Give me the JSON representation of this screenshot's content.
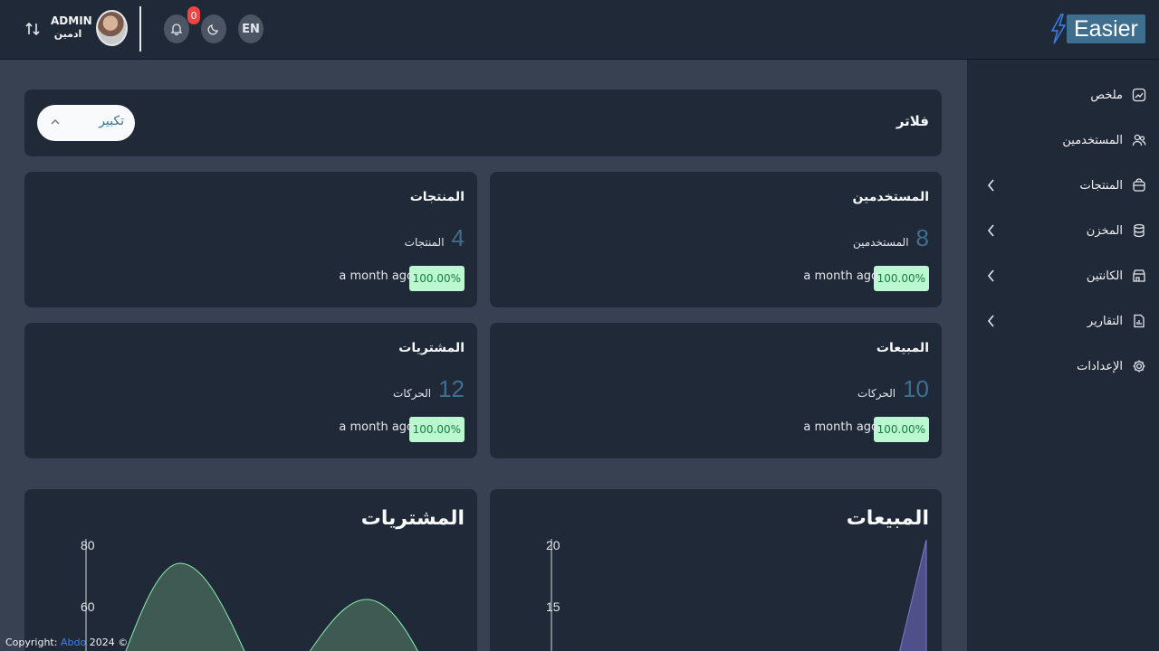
{
  "topbar": {
    "user_name": "ADMIN",
    "user_role": "ادمين",
    "notifications_count": "0",
    "lang": "EN",
    "logo": "Easier"
  },
  "sidebar": {
    "items": [
      {
        "label": "ملخص",
        "icon": "chart-line-icon",
        "has_submenu": false
      },
      {
        "label": "المستخدمين",
        "icon": "users-icon",
        "has_submenu": false
      },
      {
        "label": "المنتجات",
        "icon": "bag-icon",
        "has_submenu": true
      },
      {
        "label": "المخزن",
        "icon": "database-icon",
        "has_submenu": true
      },
      {
        "label": "الكانتين",
        "icon": "store-icon",
        "has_submenu": true
      },
      {
        "label": "التقارير",
        "icon": "report-icon",
        "has_submenu": true
      },
      {
        "label": "الإعدادات",
        "icon": "gear-icon",
        "has_submenu": false
      }
    ]
  },
  "filter": {
    "title": "فلاتر",
    "selected": "تكبير"
  },
  "stats": [
    {
      "title": "المستخدمين",
      "value": "8",
      "label": "المستخدمين",
      "pct": "100.00%",
      "ago": "a month ago"
    },
    {
      "title": "المنتجات",
      "value": "4",
      "label": "المنتجات",
      "pct": "100.00%",
      "ago": "a month ago"
    },
    {
      "title": "المبيعات",
      "value": "10",
      "label": "الحركات",
      "pct": "100.00%",
      "ago": "a month ago"
    },
    {
      "title": "المشتريات",
      "value": "12",
      "label": "الحركات",
      "pct": "100.00%",
      "ago": "a month ago"
    }
  ],
  "charts": {
    "sales_title": "المبيعات",
    "purchases_title": "المشتريات"
  },
  "chart_data": [
    {
      "type": "area",
      "title": "المبيعات",
      "yticks": [
        "20",
        "15"
      ],
      "ylim": [
        0,
        20
      ],
      "color": "#4f4f8a"
    },
    {
      "type": "area",
      "title": "المشتريات",
      "yticks": [
        "80",
        "60"
      ],
      "ylim": [
        0,
        80
      ],
      "color": "#3e5a52"
    }
  ],
  "footer": {
    "prefix": "Copyright:",
    "link": "Abdo",
    "suffix": "2024 ©"
  },
  "colors": {
    "accent": "#3f6f8f",
    "badge": "#ef4444",
    "pct_bg": "#bbf7d0",
    "pct_fg": "#15803d"
  }
}
